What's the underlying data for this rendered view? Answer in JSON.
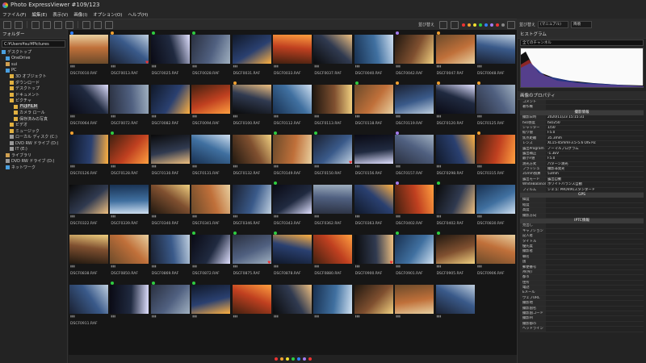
{
  "window": {
    "title": "Photo ExpressViewer   #109/123"
  },
  "menu": [
    "ファイル(F)",
    "編集(E)",
    "表示(V)",
    "画像(I)",
    "オプション(O)",
    "ヘルプ(H)"
  ],
  "toolbar": {
    "sort_label": "並び替え"
  },
  "tabs_right": {
    "label": "並び替え",
    "mode": "(マニュアル)",
    "sort": "降順"
  },
  "colors": {
    "green": "#2ecc40",
    "purple": "#a47cf0",
    "orange": "#f0a030",
    "red": "#e33333",
    "blue": "#3080ff"
  },
  "sidebar": {
    "title": "フォルダー",
    "path": "C:¥Users¥sui¥Pictures",
    "tree": [
      {
        "label": "デスクトップ",
        "level": 0,
        "icon": "desktop-icon"
      },
      {
        "label": "OneDrive",
        "level": 1,
        "icon": "cloud-icon"
      },
      {
        "label": "sui",
        "level": 1,
        "icon": "user-icon"
      },
      {
        "label": "PC",
        "level": 1,
        "icon": "pc-icon"
      },
      {
        "label": "3D オブジェクト",
        "level": 2,
        "icon": "folder-icon"
      },
      {
        "label": "ダウンロード",
        "level": 2,
        "icon": "folder-icon"
      },
      {
        "label": "デスクトップ",
        "level": 2,
        "icon": "folder-icon"
      },
      {
        "label": "ドキュメント",
        "level": 2,
        "icon": "folder-icon"
      },
      {
        "label": "ピクチャ",
        "level": 2,
        "icon": "folder-icon"
      },
      {
        "label": "FUJIFILM",
        "level": 3,
        "icon": "folder-icon",
        "selected": true
      },
      {
        "label": "カメラ ロール",
        "level": 3,
        "icon": "folder-icon"
      },
      {
        "label": "保存済みの写真",
        "level": 3,
        "icon": "folder-icon"
      },
      {
        "label": "ビデオ",
        "level": 2,
        "icon": "folder-icon"
      },
      {
        "label": "ミュージック",
        "level": 2,
        "icon": "folder-icon"
      },
      {
        "label": "ローカル ディスク (C:)",
        "level": 2,
        "icon": "drive-icon"
      },
      {
        "label": "DVD RW ドライブ (D:)",
        "level": 2,
        "icon": "drive-icon"
      },
      {
        "label": "IT (E:)",
        "level": 2,
        "icon": "drive-icon"
      },
      {
        "label": "ライブラリ",
        "level": 1,
        "icon": "library-icon"
      },
      {
        "label": "DVD RW ドライブ (D:)",
        "level": 1,
        "icon": "drive-icon"
      },
      {
        "label": "ネットワーク",
        "level": 1,
        "icon": "network-icon"
      }
    ]
  },
  "thumbnails": [
    {
      "name": "DSCF0010.RAF",
      "tag": "b",
      "heart": false
    },
    {
      "name": "DSCF0013.RAF",
      "tag": "o",
      "heart": true
    },
    {
      "name": "DSCF0025.RAF",
      "tag": "g",
      "heart": false
    },
    {
      "name": "DSCF0028.RAF",
      "tag": "g",
      "heart": false
    },
    {
      "name": "DSCF0031.RAF",
      "tag": "",
      "heart": false
    },
    {
      "name": "DSCF0033.RAF",
      "tag": "",
      "heart": false
    },
    {
      "name": "DSCF0037.RAF",
      "tag": "",
      "heart": false
    },
    {
      "name": "DSCF0040.RAF",
      "tag": "",
      "heart": false
    },
    {
      "name": "DSCF0042.RAF",
      "tag": "p",
      "heart": false
    },
    {
      "name": "DSCF0047.RAF",
      "tag": "o",
      "heart": false
    },
    {
      "name": "DSCF0048.RAF",
      "tag": "",
      "heart": false
    },
    {
      "name": "DSCF0064.RAF",
      "tag": "",
      "heart": false
    },
    {
      "name": "DSCF0072.RAF",
      "tag": "",
      "heart": false
    },
    {
      "name": "DSCF0082.RAF",
      "tag": "",
      "heart": false
    },
    {
      "name": "DSCF0094.RAF",
      "tag": "",
      "heart": false
    },
    {
      "name": "DSCF0100.RAF",
      "tag": "o",
      "heart": false
    },
    {
      "name": "DSCF0112.RAF",
      "tag": "",
      "heart": false
    },
    {
      "name": "DSCF0113.RAF",
      "tag": "",
      "heart": false
    },
    {
      "name": "DSCF0118.RAF",
      "tag": "g",
      "heart": false
    },
    {
      "name": "DSCF0119.RAF",
      "tag": "o",
      "heart": false
    },
    {
      "name": "DSCF0120.RAF",
      "tag": "o",
      "heart": false
    },
    {
      "name": "DSCF0125.RAF",
      "tag": "o",
      "heart": false
    },
    {
      "name": "DSCF0126.RAF",
      "tag": "o",
      "heart": false
    },
    {
      "name": "DSCF0128.RAF",
      "tag": "g",
      "heart": false
    },
    {
      "name": "DSCF0130.RAF",
      "tag": "",
      "heart": false
    },
    {
      "name": "DSCF0131.RAF",
      "tag": "",
      "heart": false
    },
    {
      "name": "DSCF0132.RAF",
      "tag": "",
      "heart": false
    },
    {
      "name": "DSCF0149.RAF",
      "tag": "g",
      "heart": false
    },
    {
      "name": "DSCF0150.RAF",
      "tag": "g",
      "heart": true
    },
    {
      "name": "DSCF0156.RAF",
      "tag": "",
      "heart": false
    },
    {
      "name": "DSCF0157.RAF",
      "tag": "p",
      "heart": false
    },
    {
      "name": "DSCF0298.RAF",
      "tag": "",
      "heart": false
    },
    {
      "name": "DSCF0315.RAF",
      "tag": "o",
      "heart": false
    },
    {
      "name": "DSCF0322.RAF",
      "tag": "",
      "heart": false
    },
    {
      "name": "DSCF0339.RAF",
      "tag": "",
      "heart": false
    },
    {
      "name": "DSCF0340.RAF",
      "tag": "",
      "heart": false
    },
    {
      "name": "DSCF0341.RAF",
      "tag": "",
      "heart": false
    },
    {
      "name": "DSCF0346.RAF",
      "tag": "",
      "heart": false
    },
    {
      "name": "DSCF0343.RAF",
      "tag": "g",
      "heart": false
    },
    {
      "name": "DSCF0362.RAF",
      "tag": "",
      "heart": false
    },
    {
      "name": "DSCF0363.RAF",
      "tag": "",
      "heart": false
    },
    {
      "name": "DSCF0402.RAF",
      "tag": "p",
      "heart": false
    },
    {
      "name": "DSCF0402.RAF",
      "tag": "g",
      "heart": false
    },
    {
      "name": "DSCF0830.RAF",
      "tag": "",
      "heart": false
    },
    {
      "name": "DSCF0838.RAF",
      "tag": "",
      "heart": false
    },
    {
      "name": "DSCF0850.RAF",
      "tag": "",
      "heart": false
    },
    {
      "name": "DSCF0869.RAF",
      "tag": "",
      "heart": false
    },
    {
      "name": "DSCF0872.RAF",
      "tag": "g",
      "heart": false
    },
    {
      "name": "DSCF0875.RAF",
      "tag": "g",
      "heart": true
    },
    {
      "name": "DSCF0878.RAF",
      "tag": "g",
      "heart": false
    },
    {
      "name": "DSCF0880.RAF",
      "tag": "",
      "heart": false
    },
    {
      "name": "DSCF0900.RAF",
      "tag": "",
      "heart": true
    },
    {
      "name": "DSCF0901.RAF",
      "tag": "g",
      "heart": false
    },
    {
      "name": "DSCF0905.RAF",
      "tag": "g",
      "heart": false
    },
    {
      "name": "DSCF0906.RAF",
      "tag": "",
      "heart": false
    },
    {
      "name": "DSCF0911.RAF",
      "tag": "",
      "heart": false
    },
    {
      "name": "",
      "tag": "g",
      "heart": false
    },
    {
      "name": "",
      "tag": "g",
      "heart": false
    },
    {
      "name": "",
      "tag": "g",
      "heart": false
    },
    {
      "name": "",
      "tag": "",
      "heart": false
    },
    {
      "name": "",
      "tag": "",
      "heart": false
    },
    {
      "name": "",
      "tag": "",
      "heart": false
    },
    {
      "name": "",
      "tag": "",
      "heart": false
    },
    {
      "name": "",
      "tag": "",
      "heart": false
    },
    {
      "name": "",
      "tag": "",
      "heart": false
    }
  ],
  "histogram": {
    "title": "ヒストグラム",
    "channel": "全てのチャンネル"
  },
  "properties": {
    "title": "画像のプロパティ",
    "rows": [
      {
        "k": "コメント",
        "v": ""
      },
      {
        "k": "著作権",
        "v": ""
      },
      {
        "section": "撮影情報"
      },
      {
        "k": "撮影日時",
        "v": "2020/11/23 15:15:31"
      },
      {
        "k": "ISO感度",
        "v": "ISO250"
      },
      {
        "k": "シャッター",
        "v": "1/50"
      },
      {
        "k": "絞り値",
        "v": "F5.0"
      },
      {
        "k": "焦点距離",
        "v": "35.3mm"
      },
      {
        "k": "レンズ",
        "v": "XC15-45mmF3.5-5.6 OIS PZ"
      },
      {
        "k": "露出Program",
        "v": "ノーマルプログラム"
      },
      {
        "k": "露出補正",
        "v": "-1.3EV"
      },
      {
        "k": "最小F値",
        "v": "F5.0"
      },
      {
        "k": "測光方式",
        "v": "パターン測光"
      },
      {
        "k": "フラッシュ",
        "v": "撮影非発光"
      },
      {
        "k": "35mm換算",
        "v": "53mm"
      },
      {
        "k": "露出モード",
        "v": "露出自動"
      },
      {
        "k": "WhiteBalance",
        "v": "ホワイトバランス自動"
      },
      {
        "k": "フィルム",
        "v": "シミュ: PROVIA/スタンダード"
      },
      {
        "section": "GPS"
      },
      {
        "k": "緯度",
        "v": ""
      },
      {
        "k": "経度",
        "v": ""
      },
      {
        "k": "高度",
        "v": ""
      },
      {
        "k": "撮影方向",
        "v": ""
      },
      {
        "section": "IPTC情報"
      },
      {
        "k": "見出し",
        "v": ""
      },
      {
        "k": "キャプション",
        "v": ""
      },
      {
        "k": "記入者",
        "v": ""
      },
      {
        "k": "タイトル",
        "v": ""
      },
      {
        "k": "優先度",
        "v": ""
      },
      {
        "k": "撮影者",
        "v": ""
      },
      {
        "k": "職名",
        "v": ""
      },
      {
        "k": "国",
        "v": ""
      },
      {
        "k": "郵便番号",
        "v": ""
      },
      {
        "k": "州(県)",
        "v": ""
      },
      {
        "k": "都市",
        "v": ""
      },
      {
        "k": "住所",
        "v": ""
      },
      {
        "k": "電話",
        "v": ""
      },
      {
        "k": "Eメール",
        "v": ""
      },
      {
        "k": "ウェブURL",
        "v": ""
      },
      {
        "k": "撮影地",
        "v": ""
      },
      {
        "k": "撮影国名",
        "v": ""
      },
      {
        "k": "撮影国コード",
        "v": ""
      },
      {
        "k": "撮影州",
        "v": ""
      },
      {
        "k": "撮影都市",
        "v": ""
      },
      {
        "k": "ヘッドライン",
        "v": ""
      }
    ]
  }
}
